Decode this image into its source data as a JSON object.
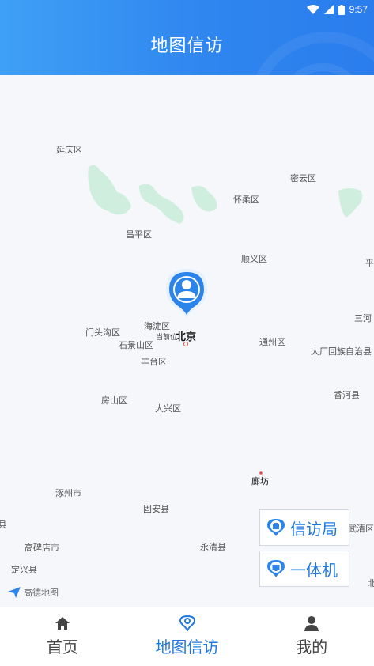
{
  "status": {
    "time": "9:57"
  },
  "header": {
    "title": "地图信访"
  },
  "map": {
    "places": {
      "yanqing": "延庆区",
      "miyun": "密云区",
      "huairou": "怀柔区",
      "changping": "昌平区",
      "shunyi": "顺义区",
      "ping": "平",
      "mentougou": "门头沟区",
      "haidian": "海淀区",
      "current": "当前位",
      "beijing": "北京",
      "shijingshan": "石景山区",
      "tongzhou": "通州区",
      "sanhe": "三河",
      "dachang": "大厂回族自治县",
      "fengtai": "丰台区",
      "xianghe": "香河县",
      "fangshan": "房山区",
      "daxing": "大兴区",
      "langfang": "廊坊",
      "zhuozhou": "涿州市",
      "guan": "固安县",
      "xian": " 县",
      "wuqing": "武清区",
      "gaobeidian": "高碑店市",
      "yongqing": "永清县",
      "dingxing": "定兴县",
      "bei": "北"
    },
    "logo_text": "高德地图",
    "colors": {
      "green": "#cfeedd",
      "accent": "#1f78e0"
    }
  },
  "buttons": {
    "xinfangju": "信访局",
    "yitiji": "一体机"
  },
  "tabs": [
    {
      "label": "首页",
      "icon": "home-icon"
    },
    {
      "label": "地图信访",
      "icon": "location-icon"
    },
    {
      "label": "我的",
      "icon": "user-icon"
    }
  ]
}
